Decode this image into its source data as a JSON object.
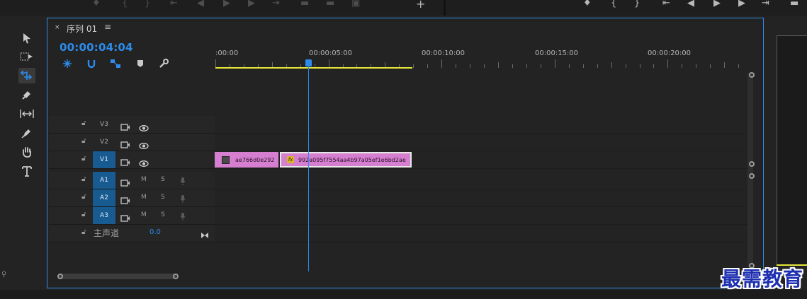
{
  "sequence": {
    "tab_close": "×",
    "title": "序列 01",
    "menu_icon": "hamburger-menu-icon",
    "timecode": "00:00:04:04"
  },
  "ruler": {
    "labels": [
      ":00:00",
      "00:00:05:00",
      "00:00:10:00",
      "00:00:15:00",
      "00:00:20:00"
    ]
  },
  "video_tracks": [
    {
      "name": "V3",
      "selected": false
    },
    {
      "name": "V2",
      "selected": false
    },
    {
      "name": "V1",
      "selected": true
    }
  ],
  "audio_tracks": [
    {
      "name": "A1",
      "selected": true,
      "m": "M",
      "s": "S"
    },
    {
      "name": "A2",
      "selected": true,
      "m": "M",
      "s": "S"
    },
    {
      "name": "A3",
      "selected": true,
      "m": "M",
      "s": "S"
    }
  ],
  "master": {
    "label": "主声道",
    "value": "0.0"
  },
  "clips": [
    {
      "name": "ae766d0e292",
      "track": "V1",
      "badge": "thumbnail-icon"
    },
    {
      "name": "992a095f7554aa4b97a05ef1e6bd2ae",
      "track": "V1",
      "badge": "fx",
      "selected": true
    }
  ],
  "colors": {
    "accent": "#2d8ceb",
    "clip": "#d67fd1",
    "workarea": "#e6e63a",
    "track_selected": "#175b91"
  },
  "watermark": "最需教育"
}
